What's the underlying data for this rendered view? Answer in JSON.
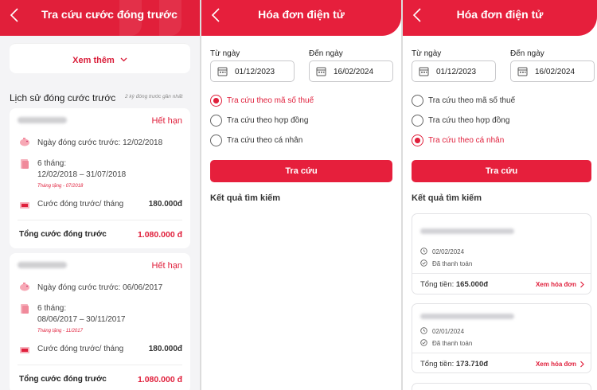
{
  "panel1": {
    "title": "Tra cứu cước đóng trước",
    "more_label": "Xem thêm",
    "section_title": "Lịch sử đóng cước trước",
    "section_note": "2 kỳ đóng trước gần nhất",
    "records": [
      {
        "status": "Hết hạn",
        "paid_date_label": "Ngày đóng cước trước: 12/02/2018",
        "period_months": "6 tháng:",
        "period_range": "12/02/2018 – 31/07/2018",
        "gift": "Tháng tặng - 07/2018",
        "fee_label": "Cước đóng trước/ tháng",
        "fee_value": "180.000đ",
        "total_label": "Tổng cước đóng trước",
        "total_value": "1.080.000 đ"
      },
      {
        "status": "Hết hạn",
        "paid_date_label": "Ngày đóng cước trước: 06/06/2017",
        "period_months": "6 tháng:",
        "period_range": "08/06/2017 – 30/11/2017",
        "gift": "Tháng tặng - 11/2017",
        "fee_label": "Cước đóng trước/ tháng",
        "fee_value": "180.000đ",
        "total_label": "Tổng cước đóng trước",
        "total_value": "1.080.000 đ"
      }
    ]
  },
  "panel2": {
    "title": "Hóa đơn điện tử",
    "from_label": "Từ ngày",
    "from_value": "01/12/2023",
    "to_label": "Đến ngày",
    "to_value": "16/02/2024",
    "options": [
      "Tra cứu theo mã số thuế",
      "Tra cứu theo hợp đồng",
      "Tra cứu theo cá nhân"
    ],
    "selected": 0,
    "search_label": "Tra cứu",
    "results_title": "Kết quả tìm kiếm"
  },
  "panel3": {
    "title": "Hóa đơn điện tử",
    "from_label": "Từ ngày",
    "from_value": "01/12/2023",
    "to_label": "Đến ngày",
    "to_value": "16/02/2024",
    "options": [
      "Tra cứu theo mã số thuế",
      "Tra cứu theo hợp đồng",
      "Tra cứu theo cá nhân"
    ],
    "selected": 2,
    "search_label": "Tra cứu",
    "results_title": "Kết quả tìm kiếm",
    "invoices": [
      {
        "date": "02/02/2024",
        "status": "Đã thanh toán",
        "total_label": "Tổng tiền:",
        "total_value": "165.000đ",
        "view_label": "Xem hóa đơn"
      },
      {
        "date": "02/01/2024",
        "status": "Đã thanh toán",
        "total_label": "Tổng tiền:",
        "total_value": "173.710đ",
        "view_label": "Xem hóa đơn"
      }
    ]
  },
  "colors": {
    "brand_red": "#e61f3c",
    "text_dark": "#222222",
    "muted": "#888888"
  },
  "icons": [
    "back-chevron-icon",
    "chevron-down-icon",
    "piggy-bank-icon",
    "calendar-pages-icon",
    "money-card-icon",
    "calendar-icon",
    "clock-icon",
    "check-circle-icon",
    "chevron-right-icon"
  ]
}
